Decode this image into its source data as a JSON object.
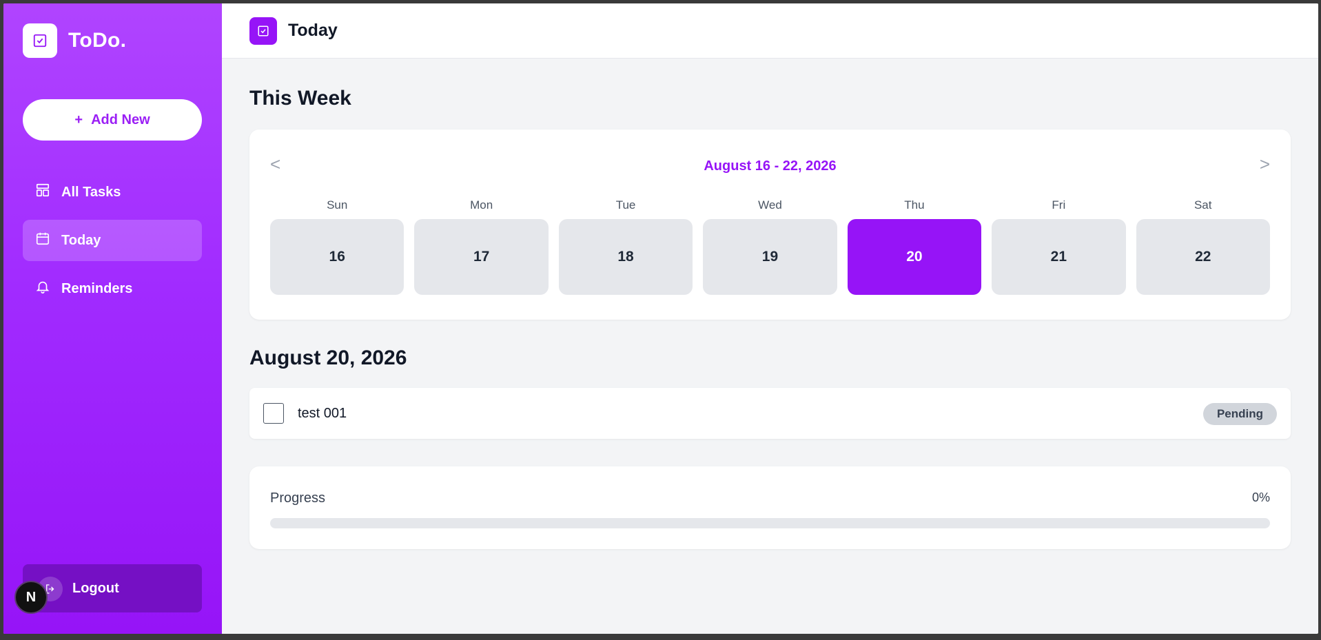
{
  "app": {
    "name": "ToDo."
  },
  "sidebar": {
    "add_label": "Add New",
    "add_icon": "+",
    "items": [
      {
        "label": "All Tasks",
        "icon": "layout-icon",
        "active": false
      },
      {
        "label": "Today",
        "icon": "calendar-icon",
        "active": true
      },
      {
        "label": "Reminders",
        "icon": "bell-icon",
        "active": false
      }
    ],
    "logout_label": "Logout",
    "badge_letter": "N"
  },
  "header": {
    "title": "Today"
  },
  "week": {
    "title": "This Week",
    "range": "August 16 - 22, 2026",
    "prev": "<",
    "next": ">",
    "days": [
      {
        "name": "Sun",
        "date": "16",
        "selected": false
      },
      {
        "name": "Mon",
        "date": "17",
        "selected": false
      },
      {
        "name": "Tue",
        "date": "18",
        "selected": false
      },
      {
        "name": "Wed",
        "date": "19",
        "selected": false
      },
      {
        "name": "Thu",
        "date": "20",
        "selected": true
      },
      {
        "name": "Fri",
        "date": "21",
        "selected": false
      },
      {
        "name": "Sat",
        "date": "22",
        "selected": false
      }
    ]
  },
  "day_view": {
    "title": "August 20, 2026",
    "tasks": [
      {
        "name": "test 001",
        "status": "Pending",
        "done": false
      }
    ]
  },
  "progress": {
    "label": "Progress",
    "value_text": "0%",
    "fraction": 0
  },
  "colors": {
    "accent": "#9614f7",
    "sidebar_top": "#b044ff",
    "badge_bg": "#d1d5db"
  }
}
